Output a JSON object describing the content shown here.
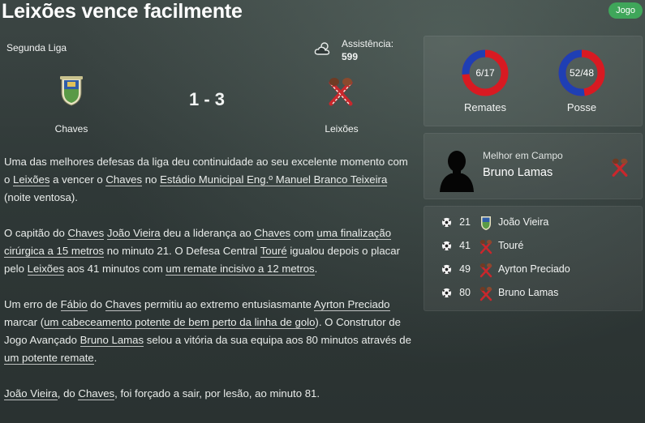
{
  "headline": "Leixões vence facilmente",
  "badge": "Jogo",
  "match": {
    "league": "Segunda Liga",
    "weather_icon": "cloud-icon",
    "attendance_label": "Assistência:",
    "attendance_value": "599",
    "home_team": "Chaves",
    "away_team": "Leixões",
    "score": "1 - 3"
  },
  "report": {
    "p1": [
      {
        "t": "Uma das melhores defesas da liga deu continuidade ao seu excelente momento com o "
      },
      {
        "t": "Leixões",
        "link": true
      },
      {
        "t": " a vencer o "
      },
      {
        "t": "Chaves",
        "link": true
      },
      {
        "t": " no "
      },
      {
        "t": "Estádio Municipal Eng.º Manuel Branco Teixeira",
        "link": true
      },
      {
        "t": " (noite ventosa)."
      }
    ],
    "p2": [
      {
        "t": "O capitão do "
      },
      {
        "t": "Chaves",
        "link": true
      },
      {
        "t": " "
      },
      {
        "t": "João Vieira",
        "link": true
      },
      {
        "t": " deu a liderança ao "
      },
      {
        "t": "Chaves",
        "link": true
      },
      {
        "t": " com "
      },
      {
        "t": "uma finalização cirúrgica a 15 metros",
        "link": true
      },
      {
        "t": " no minuto 21. O Defesa Central "
      },
      {
        "t": "Touré",
        "link": true
      },
      {
        "t": " igualou depois o placar pelo "
      },
      {
        "t": "Leixões",
        "link": true
      },
      {
        "t": " aos 41 minutos com "
      },
      {
        "t": "um remate incisivo a 12 metros",
        "link": true
      },
      {
        "t": "."
      }
    ],
    "p3": [
      {
        "t": "Um erro de "
      },
      {
        "t": "Fábio",
        "link": true
      },
      {
        "t": " do "
      },
      {
        "t": "Chaves",
        "link": true
      },
      {
        "t": " permitiu ao extremo entusiasmante "
      },
      {
        "t": "Ayrton Preciado",
        "link": true
      },
      {
        "t": " marcar ("
      },
      {
        "t": "um cabeceamento potente de bem perto da linha de golo",
        "link": true
      },
      {
        "t": "). O Construtor de Jogo Avançado "
      },
      {
        "t": "Bruno Lamas",
        "link": true
      },
      {
        "t": " selou a vitória da sua equipa aos 80 minutos através de "
      },
      {
        "t": "um potente remate",
        "link": true
      },
      {
        "t": "."
      }
    ],
    "p4": [
      {
        "t": "João Vieira",
        "link": true
      },
      {
        "t": ", do "
      },
      {
        "t": "Chaves",
        "link": true
      },
      {
        "t": ", foi forçado a sair, por lesão, ao minuto 81."
      }
    ]
  },
  "stats": {
    "shots": {
      "label": "Remates",
      "value": "6/17",
      "home": 6,
      "away": 17
    },
    "possession": {
      "label": "Posse",
      "value": "52/48",
      "home": 52,
      "away": 48
    },
    "home_color": "#1f3fb4",
    "away_color": "#d81a22"
  },
  "motm": {
    "label": "Melhor em Campo",
    "name": "Bruno Lamas"
  },
  "events": [
    {
      "minute": "21",
      "player": "João Vieira",
      "team": "home"
    },
    {
      "minute": "41",
      "player": "Touré",
      "team": "away"
    },
    {
      "minute": "49",
      "player": "Ayrton Preciado",
      "team": "away"
    },
    {
      "minute": "80",
      "player": "Bruno Lamas",
      "team": "away"
    }
  ]
}
